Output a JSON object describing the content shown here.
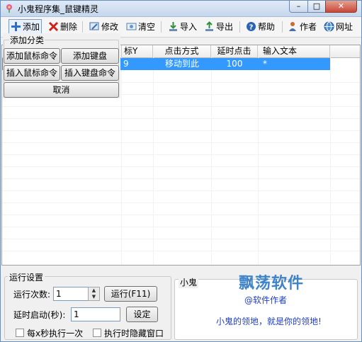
{
  "window": {
    "title": "小鬼程序集_鼠键精灵"
  },
  "toolbar": {
    "add": "添加",
    "delete": "删除",
    "edit": "修改",
    "clear": "清空",
    "import": "导入",
    "export": "导出",
    "help": "帮助",
    "author": "作者",
    "website": "网址"
  },
  "popup": {
    "legend": "添加分类",
    "add_mouse": "添加鼠标命令",
    "add_keyboard": "添加键盘",
    "insert_mouse": "插入鼠标命令",
    "insert_keyboard": "插入键盘命令",
    "cancel": "取消"
  },
  "grid": {
    "columns": [
      "标Y",
      "点击方式",
      "延时点击",
      "输入文本"
    ],
    "rows": [
      {
        "y": "9",
        "method": "移动到此",
        "delay": "100",
        "text": "*"
      }
    ]
  },
  "settings": {
    "legend": "运行设置",
    "run_count_label": "运行次数:",
    "run_count_value": "1",
    "run_button": "运行(F11)",
    "delay_start_label": "延时启动(秒):",
    "delay_start_value": "1",
    "set_button": "设定",
    "every_x_label": "每x秒执行一次",
    "hide_window_label": "执行时隐藏窗口"
  },
  "panel": {
    "legend": "小鬼",
    "author_link": "@软件作者",
    "slogan": "小鬼的领地，就是你的领地!"
  },
  "watermark": "飘荡软件",
  "colors": {
    "selection": "#3399ff",
    "link": "#1e3cc8",
    "accent": "#3f83c9"
  }
}
